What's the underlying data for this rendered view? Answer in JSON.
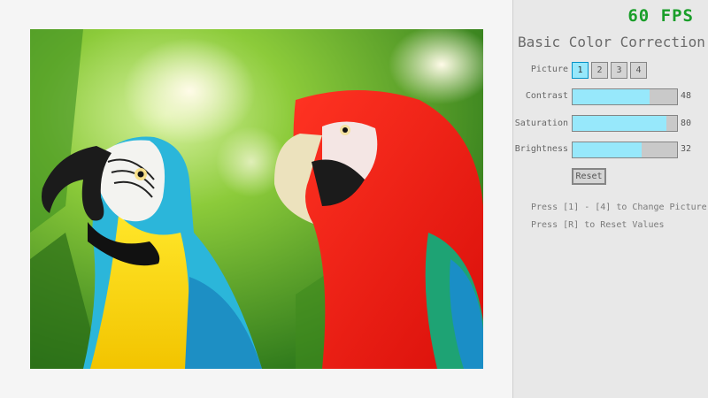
{
  "fps": "60 FPS",
  "title": "Basic Color Correction",
  "picture_label": "Picture",
  "picture_buttons": [
    "1",
    "2",
    "3",
    "4"
  ],
  "selected_picture": "1",
  "contrast": {
    "label": "Contrast",
    "value": "48",
    "fraction": 0.74
  },
  "saturation": {
    "label": "Saturation",
    "value": "80",
    "fraction": 0.9
  },
  "brightness": {
    "label": "Brightness",
    "value": "32",
    "fraction": 0.66
  },
  "reset_label": "Reset",
  "hints": [
    "Press [1] - [4] to Change Picture",
    "Press [R] to Reset Values"
  ],
  "colors": {
    "accent_fill": "#97e8fb",
    "accent_border": "#0492c7",
    "fps": "#1a9e2a"
  }
}
